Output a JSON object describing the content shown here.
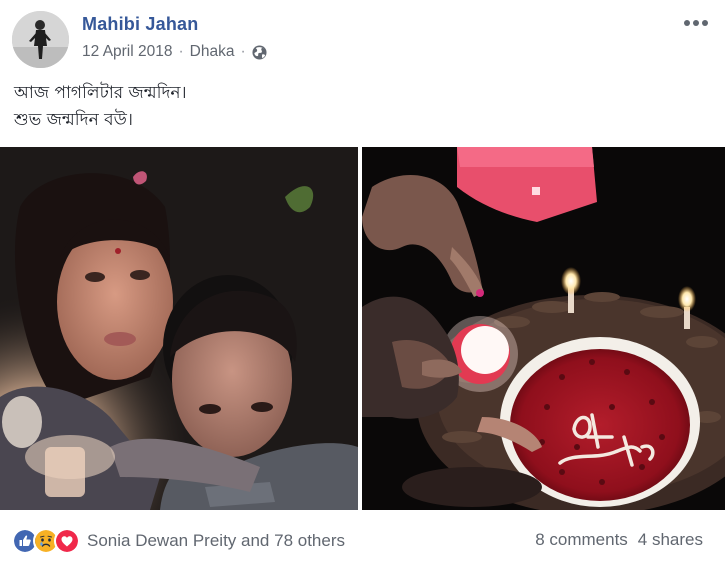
{
  "post": {
    "author": "Mahibi Jahan",
    "date": "12 April 2018",
    "separator": "·",
    "location": "Dhaka",
    "privacy_icon": "globe-icon",
    "more_icon": "more-horizontal-icon",
    "text_lines": [
      "আজ পাগলিটার জন্মদিন।",
      "শুভ জন্মদিন বউ।"
    ],
    "photos": [
      {
        "icon": "photo-couple-selfie"
      },
      {
        "icon": "photo-birthday-cake"
      }
    ]
  },
  "footer": {
    "reaction_icons": [
      "like-icon",
      "sad-icon",
      "love-icon"
    ],
    "reactors_text": "Sonia Dewan Preity and 78 others",
    "comments": "8 comments",
    "shares": "4 shares"
  },
  "colors": {
    "author": "#365899",
    "meta": "#616770",
    "like": "#4267b2",
    "sad": "#f7b125",
    "love": "#f0284a"
  }
}
